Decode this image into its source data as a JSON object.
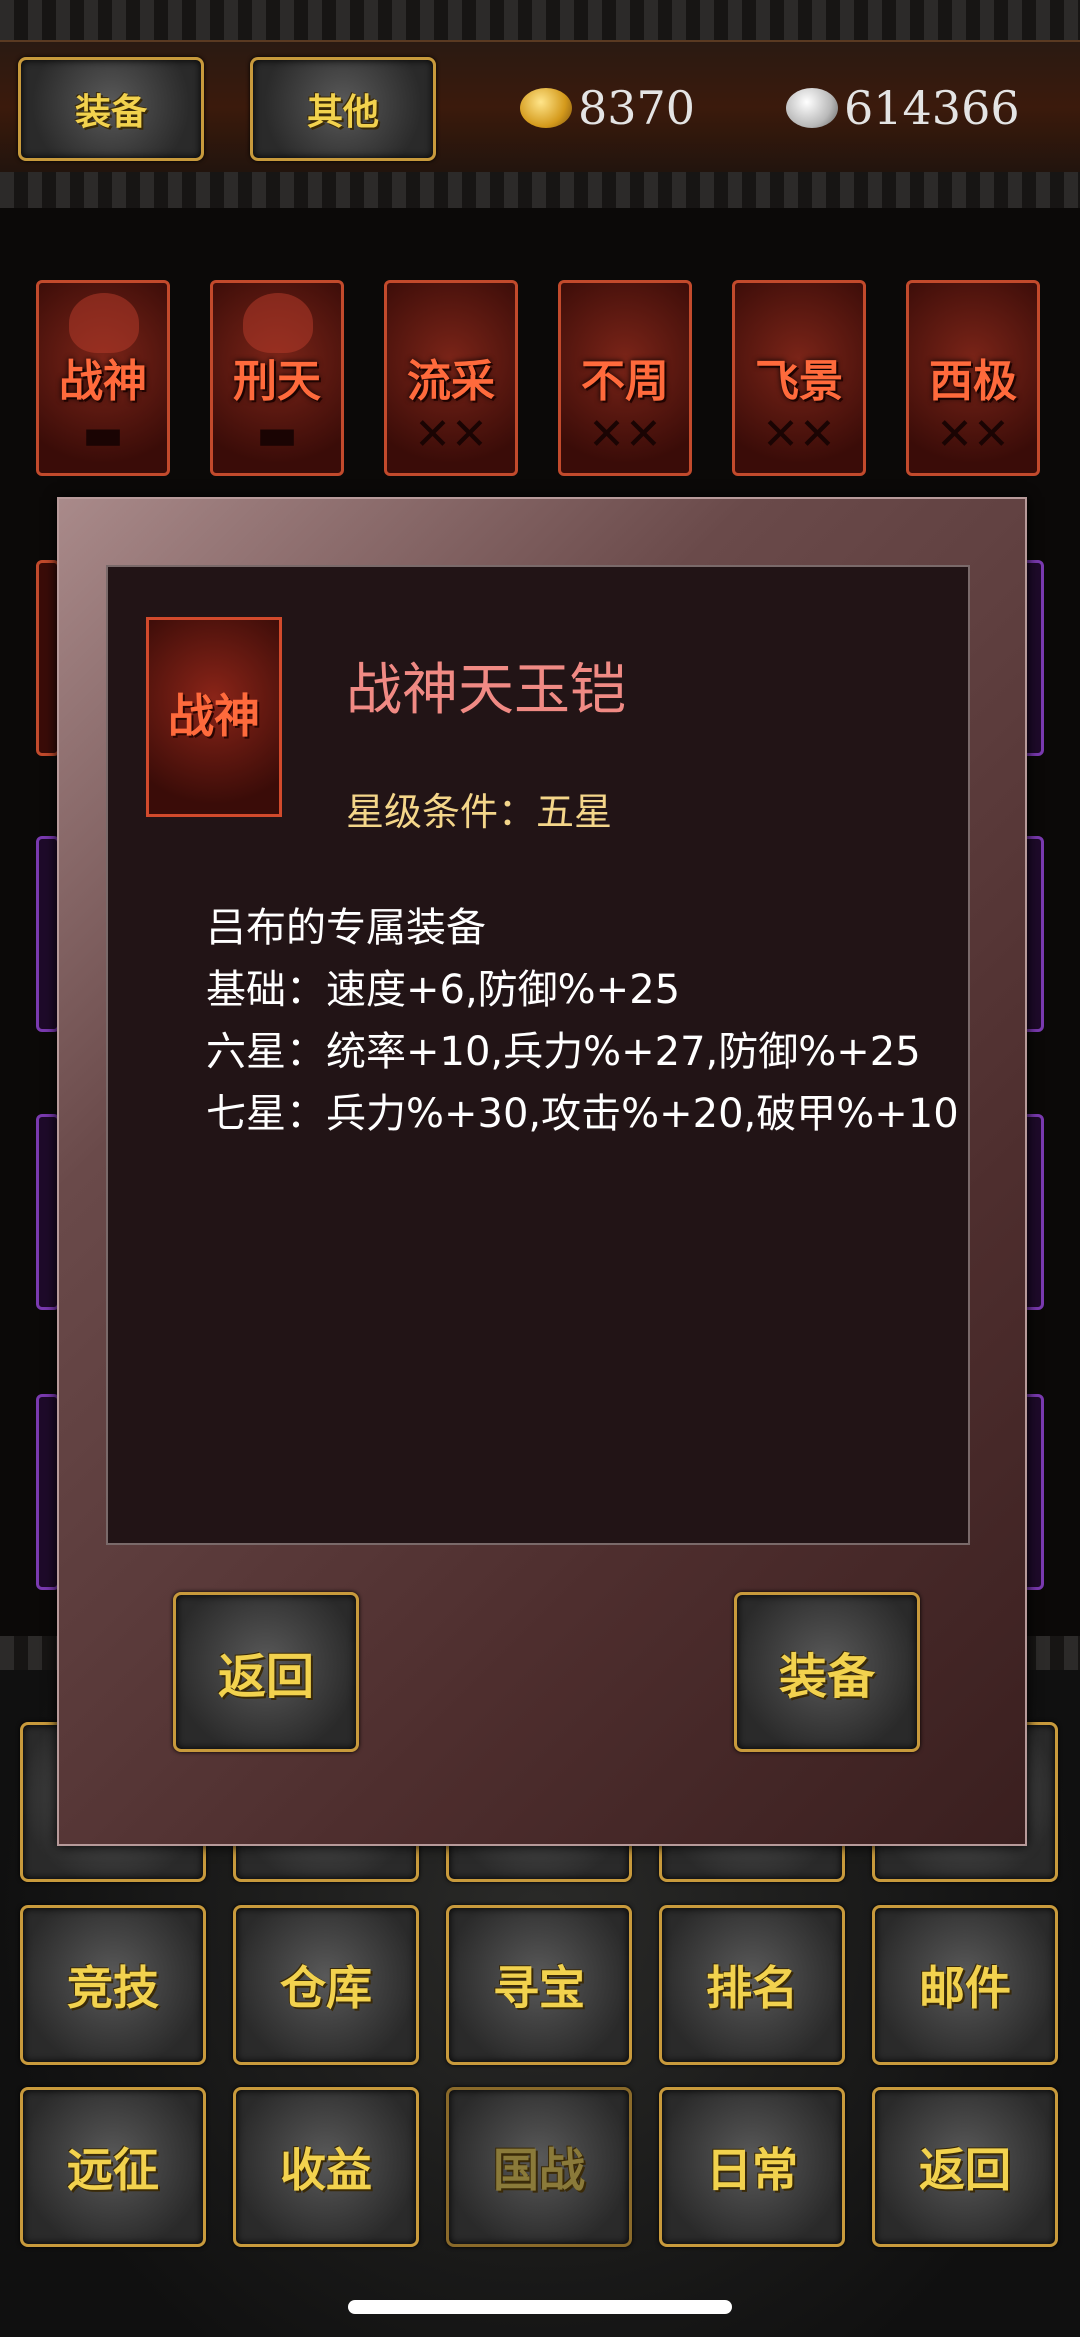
{
  "header": {
    "tab_equip": "装备",
    "tab_other": "其他",
    "gold_amount": "8370",
    "silver_amount": "614366",
    "gold_icon": "gold-ingot-icon",
    "silver_icon": "silver-ingot-icon"
  },
  "gear_row": [
    {
      "label": "战神"
    },
    {
      "label": "刑天"
    },
    {
      "label": "流采"
    },
    {
      "label": "不周"
    },
    {
      "label": "飞景"
    },
    {
      "label": "西极"
    }
  ],
  "dialog": {
    "icon_label": "战神",
    "item_name": "战神天玉铠",
    "star_requirement": "星级条件：五星",
    "description": [
      "吕布的专属装备",
      "基础：速度+6,防御%+25",
      "六星：统率+10,兵力%+27,防御%+25",
      "七星：兵力%+30,攻击%+20,破甲%+10"
    ],
    "back_button": "返回",
    "equip_button": "装备"
  },
  "menu": {
    "row1": [
      "竞技",
      "仓库",
      "寻宝",
      "排名",
      "邮件"
    ],
    "row2": [
      "远征",
      "收益",
      "国战",
      "日常",
      "返回"
    ]
  },
  "colors": {
    "gold_text": "#f2d24e",
    "item_name": "#f08a84",
    "star_text": "#f4d68a",
    "tile_border": "#c24a2c"
  }
}
